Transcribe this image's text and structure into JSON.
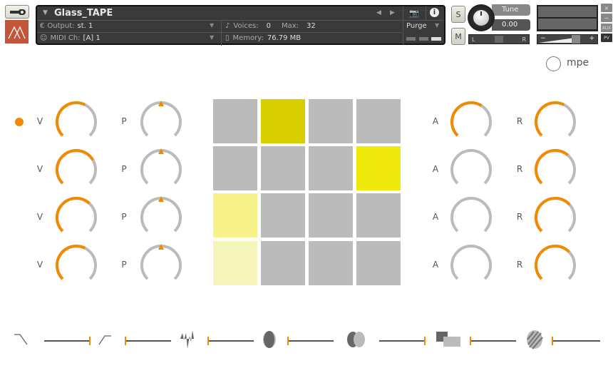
{
  "header": {
    "instrument_name": "Glass_TAPE",
    "output_label": "Output:",
    "output_value": "st. 1",
    "midi_label": "MIDI Ch:",
    "midi_value": "[A]  1",
    "voices_label": "Voices:",
    "voices_value": "0",
    "max_label": "Max:",
    "max_value": "32",
    "memory_label": "Memory:",
    "memory_value": "76.79 MB",
    "purge_label": "Purge",
    "solo_label": "S",
    "mute_label": "M",
    "tune_label": "Tune",
    "tune_value": "0.00",
    "pan_left": "L",
    "pan_right": "R",
    "vol_minus": "−",
    "vol_plus": "+",
    "side_buttons": [
      "×",
      "−",
      "AUX",
      "PV"
    ]
  },
  "mpe": {
    "label": "mpe",
    "enabled": false
  },
  "colors": {
    "accent": "#f28a00",
    "knob_track": "#bbbbbb",
    "pad_off": "#bbbbbb",
    "panel": "#3a3a3a",
    "logo": "#c2553a"
  },
  "rows": [
    {
      "active": true,
      "v_label": "V",
      "v_value": 0.6,
      "p_label": "P",
      "p_value": 0.5,
      "a_label": "A",
      "a_value": 0.62,
      "r_label": "R",
      "r_value": 0.6
    },
    {
      "active": false,
      "v_label": "V",
      "v_value": 0.72,
      "p_label": "P",
      "p_value": 0.5,
      "a_label": "A",
      "a_value": 0,
      "r_label": "R",
      "r_value": 0.65
    },
    {
      "active": false,
      "v_label": "V",
      "v_value": 0.66,
      "p_label": "P",
      "p_value": 0.5,
      "a_label": "A",
      "a_value": 0,
      "r_label": "R",
      "r_value": 0.68
    },
    {
      "active": false,
      "v_label": "V",
      "v_value": 0.6,
      "p_label": "P",
      "p_value": 0.5,
      "a_label": "A",
      "a_value": 0,
      "r_label": "R",
      "r_value": 0.67
    }
  ],
  "pads": [
    [
      "#bbbbbb",
      "#d8cf00",
      "#bbbbbb",
      "#bbbbbb"
    ],
    [
      "#bbbbbb",
      "#bbbbbb",
      "#bbbbbb",
      "#eee80c"
    ],
    [
      "#f7f38a",
      "#bbbbbb",
      "#bbbbbb",
      "#bbbbbb"
    ],
    [
      "#f5f4bb",
      "#bbbbbb",
      "#bbbbbb",
      "#bbbbbb"
    ]
  ],
  "effects": [
    {
      "icon": "lowpass-filter-icon",
      "value": 1
    },
    {
      "icon": "highpass-filter-icon",
      "value": 0
    },
    {
      "icon": "distortion-icon",
      "value": 0
    },
    {
      "icon": "phaser-icon",
      "value": 0
    },
    {
      "icon": "chorus-icon",
      "value": 1
    },
    {
      "icon": "delay-icon",
      "value": 0
    },
    {
      "icon": "reverb-icon",
      "value": 0
    }
  ]
}
